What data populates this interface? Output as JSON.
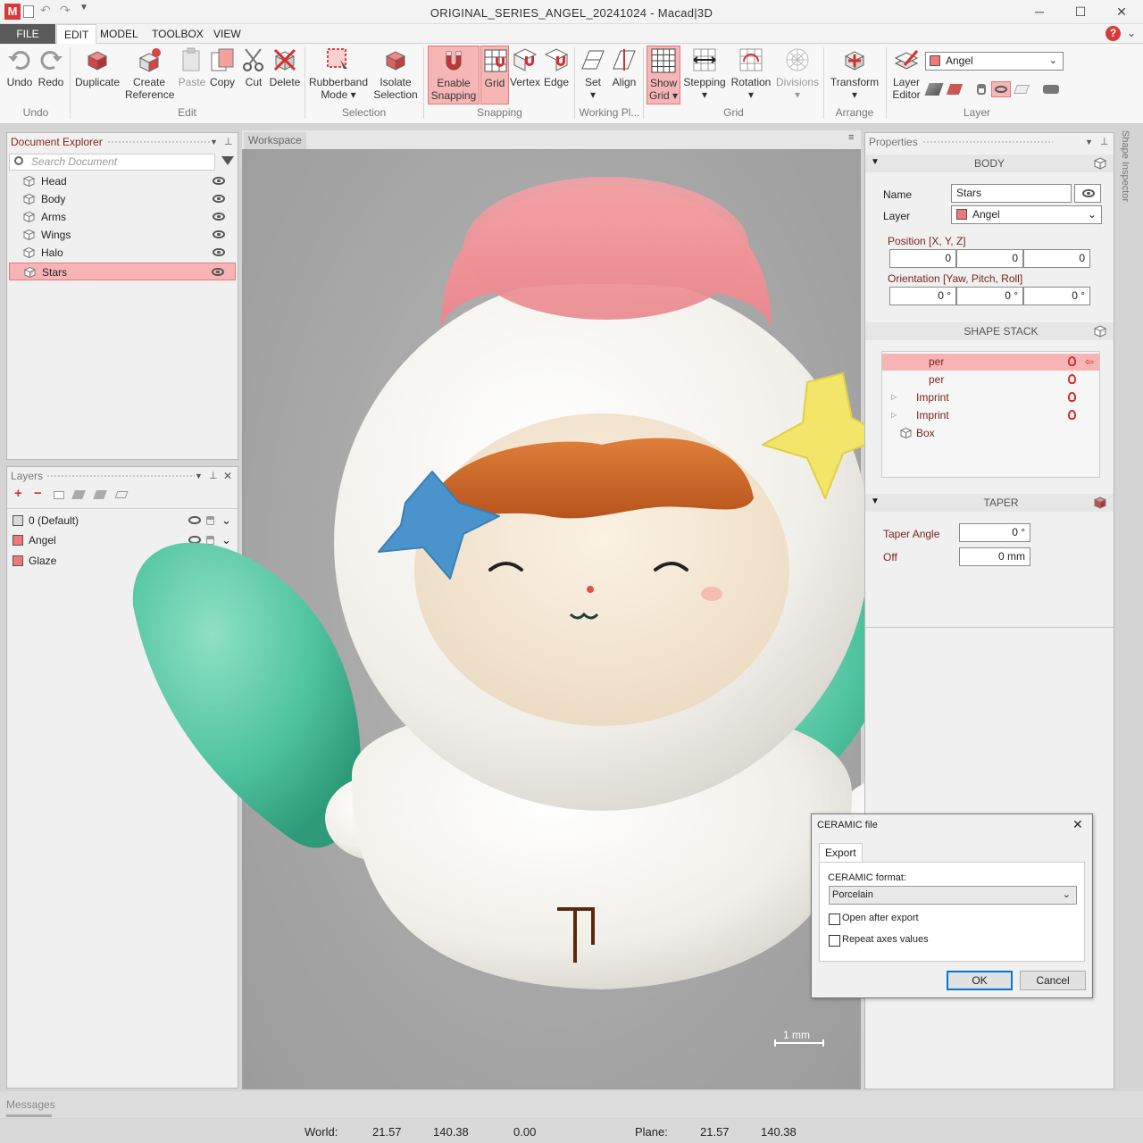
{
  "window": {
    "title": "ORIGINAL_SERIES_ANGEL_20241024 - Macad|3D",
    "app_icon_label": "M",
    "minimize": "─",
    "maximize": "☐",
    "close": "✕"
  },
  "menu": {
    "tabs": [
      "FILE",
      "EDIT",
      "MODEL",
      "TOOLBOX",
      "VIEW"
    ],
    "active": "EDIT",
    "help": "?"
  },
  "ribbon": {
    "buttons": {
      "undo": "Undo",
      "redo": "Redo",
      "duplicate": "Duplicate",
      "create_ref_1": "Create",
      "create_ref_2": "Reference",
      "paste": "Paste",
      "copy": "Copy",
      "cut": "Cut",
      "delete": "Delete",
      "rubberband_1": "Rubberband",
      "rubberband_2": "Mode ▾",
      "isolate_1": "Isolate",
      "isolate_2": "Selection",
      "snapping_1": "Enable",
      "snapping_2": "Snapping",
      "grid": "Grid",
      "vertex": "Vertex",
      "edge": "Edge",
      "set": "Set",
      "set_arrow": "▾",
      "align": "Align",
      "showgrid_1": "Show",
      "showgrid_2": "Grid ▾",
      "stepping": "Stepping",
      "stepping_arrow": "▾",
      "rotation": "Rotation",
      "rotation_arrow": "▾",
      "divisions": "Divisions",
      "divisions_arrow": "▾",
      "transform": "Transform",
      "transform_arrow": "▾",
      "layer_editor_1": "Layer",
      "layer_editor_2": "Editor"
    },
    "groups": [
      "Undo",
      "Edit",
      "Selection",
      "Snapping",
      "Working Pl...",
      "Grid",
      "Arrange",
      "Layer"
    ],
    "layer_select": "Angel",
    "accent": "#e95555"
  },
  "doc_explorer": {
    "title": "Document Explorer",
    "search_placeholder": "Search Document",
    "items": [
      {
        "label": "Head"
      },
      {
        "label": "Body"
      },
      {
        "label": "Arms"
      },
      {
        "label": "Wings"
      },
      {
        "label": "Halo"
      },
      {
        "label": "Stars",
        "selected": true
      }
    ]
  },
  "layers": {
    "title": "Layers",
    "items": [
      {
        "label": "0 (Default)",
        "color": "#d9d9d9"
      },
      {
        "label": "Angel",
        "color": "#f07878"
      },
      {
        "label": "Glaze",
        "color": "#f07878"
      }
    ]
  },
  "workspace": {
    "title": "Workspace",
    "scale_label": "1 mm"
  },
  "properties": {
    "title": "Properties",
    "side_tab": "Shape Inspector",
    "body": {
      "section": "BODY",
      "name_label": "Name",
      "name_value": "Stars",
      "layer_label": "Layer",
      "layer_value": "Angel",
      "position_label": "Position [X, Y, Z]",
      "position": [
        "0",
        "0",
        "0"
      ],
      "orientation_label": "Orientation [Yaw, Pitch, Roll]",
      "orientation": [
        "0 °",
        "0 °",
        "0 °"
      ]
    },
    "shape_stack": {
      "section": "SHAPE STACK",
      "items": [
        {
          "label": "per",
          "selected": true
        },
        {
          "label": "per"
        },
        {
          "label": "Imprint"
        },
        {
          "label": "Imprint"
        },
        {
          "label": "Box"
        }
      ]
    },
    "taper": {
      "section": "TAPER",
      "angle_label": "Taper Angle",
      "angle_value": "0 °",
      "offset_label": "Off",
      "offset_value": "0 mm"
    }
  },
  "dialog": {
    "title": "CERAMIC file",
    "tab": "Export",
    "format_label": "CERAMIC format:",
    "format_value": "Porcelain",
    "open_after": "Open after export",
    "repeat_axes": "Repeat axes values",
    "ok": "OK",
    "cancel": "Cancel"
  },
  "messages": {
    "title": "Messages"
  },
  "status": {
    "world_label": "World:",
    "world_x": "21.57",
    "world_y": "140.38",
    "world_z": "0.00",
    "plane_label": "Plane:",
    "plane_x": "21.57",
    "plane_y": "140.38"
  }
}
